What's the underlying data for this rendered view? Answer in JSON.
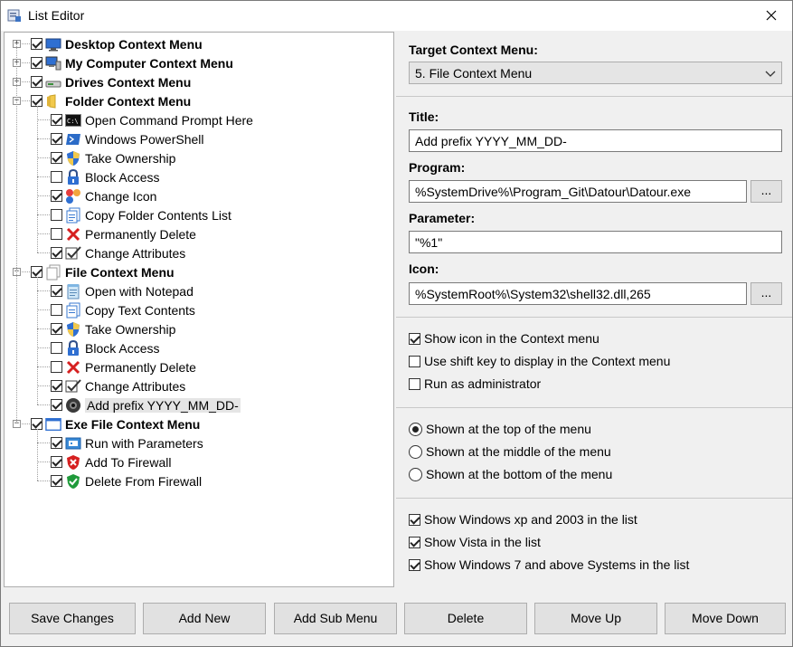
{
  "window": {
    "title": "List Editor"
  },
  "tree": {
    "groups": [
      {
        "label": "Desktop Context Menu",
        "checked": true,
        "expanded": false,
        "icon": "desktop-icon"
      },
      {
        "label": "My Computer Context Menu",
        "checked": true,
        "expanded": false,
        "icon": "computer-icon"
      },
      {
        "label": "Drives Context Menu",
        "checked": true,
        "expanded": false,
        "icon": "drive-icon"
      },
      {
        "label": "Folder Context Menu",
        "checked": true,
        "expanded": true,
        "icon": "folder-icon",
        "items": [
          {
            "label": "Open Command Prompt Here",
            "checked": true,
            "icon": "cmd-icon"
          },
          {
            "label": "Windows PowerShell",
            "checked": true,
            "icon": "powershell-icon"
          },
          {
            "label": "Take Ownership",
            "checked": true,
            "icon": "shield-icon"
          },
          {
            "label": "Block Access",
            "checked": false,
            "icon": "lock-icon"
          },
          {
            "label": "Change Icon",
            "checked": true,
            "icon": "change-icon-icon"
          },
          {
            "label": "Copy Folder Contents List",
            "checked": false,
            "icon": "copy-list-icon"
          },
          {
            "label": "Permanently Delete",
            "checked": false,
            "icon": "delete-x-icon"
          },
          {
            "label": "Change Attributes",
            "checked": true,
            "icon": "attributes-icon"
          }
        ]
      },
      {
        "label": "File Context Menu",
        "checked": true,
        "expanded": true,
        "icon": "file-icon",
        "items": [
          {
            "label": "Open with Notepad",
            "checked": true,
            "icon": "notepad-icon"
          },
          {
            "label": "Copy Text Contents",
            "checked": false,
            "icon": "copy-text-icon"
          },
          {
            "label": "Take Ownership",
            "checked": true,
            "icon": "shield-icon"
          },
          {
            "label": "Block Access",
            "checked": false,
            "icon": "lock-icon"
          },
          {
            "label": "Permanently Delete",
            "checked": false,
            "icon": "delete-x-icon"
          },
          {
            "label": "Change Attributes",
            "checked": true,
            "icon": "attributes-icon"
          },
          {
            "label": "Add prefix YYYY_MM_DD-",
            "checked": true,
            "icon": "camera-lens-icon",
            "selected": true
          }
        ]
      },
      {
        "label": "Exe File Context Menu",
        "checked": true,
        "expanded": true,
        "icon": "window-icon",
        "items": [
          {
            "label": "Run with Parameters",
            "checked": true,
            "icon": "run-params-icon"
          },
          {
            "label": "Add To Firewall",
            "checked": true,
            "icon": "firewall-block-icon"
          },
          {
            "label": "Delete From Firewall",
            "checked": true,
            "icon": "firewall-allow-icon"
          }
        ]
      }
    ]
  },
  "form": {
    "target_label": "Target Context Menu:",
    "target_value": "5. File Context Menu",
    "title_label": "Title:",
    "title_value": "Add prefix YYYY_MM_DD-",
    "program_label": "Program:",
    "program_value": "%SystemDrive%\\Program_Git\\Datour\\Datour.exe",
    "parameter_label": "Parameter:",
    "parameter_value": "\"%1\"",
    "icon_label": "Icon:",
    "icon_value": "%SystemRoot%\\System32\\shell32.dll,265",
    "browse_label": "..."
  },
  "options": {
    "show_icon": {
      "label": "Show icon in the Context menu",
      "checked": true
    },
    "shift_key": {
      "label": "Use shift key to display in the Context menu",
      "checked": false
    },
    "run_admin": {
      "label": "Run as administrator",
      "checked": false
    }
  },
  "position": {
    "top": {
      "label": "Shown at the top of the menu",
      "selected": true
    },
    "middle": {
      "label": "Shown at the middle of the menu",
      "selected": false
    },
    "bottom": {
      "label": "Shown at the bottom of the menu",
      "selected": false
    }
  },
  "systems": {
    "xp": {
      "label": "Show Windows xp  and 2003 in the list",
      "checked": true
    },
    "vista": {
      "label": "Show Vista in the list",
      "checked": true
    },
    "win7": {
      "label": "Show Windows 7 and above Systems in the list",
      "checked": true
    }
  },
  "buttons": {
    "save": "Save Changes",
    "add_new": "Add New",
    "add_sub": "Add Sub Menu",
    "delete": "Delete",
    "move_up": "Move Up",
    "move_down": "Move Down"
  }
}
